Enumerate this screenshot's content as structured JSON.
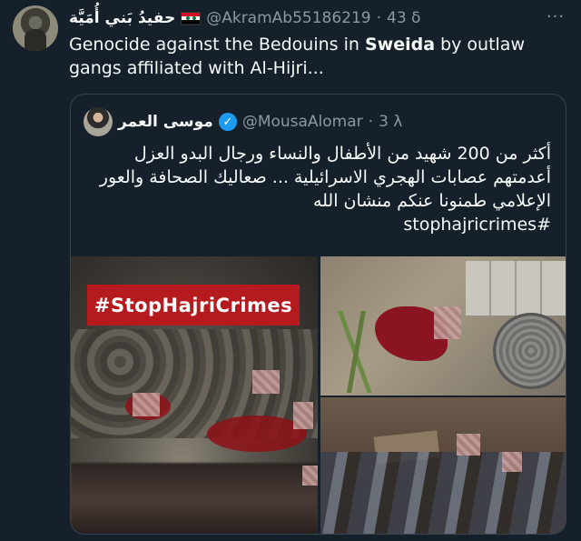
{
  "tweet": {
    "author_name": "حفيدُ بَني أُمَيَّة",
    "flag_icon": "syria-flag-icon",
    "handle": "@AkramAb55186219",
    "separator": "·",
    "time": "43 δ",
    "more_icon": "more-options-icon",
    "text_part1": "Genocide against the Bedouins in ",
    "text_bold": "Sweida",
    "text_part2": " by outlaw gangs affiliated with Al-Hijri..."
  },
  "quoted": {
    "author_name": "موسى العمر",
    "verified_icon": "verified-badge-icon",
    "handle": "@MousaAlomar",
    "separator": "·",
    "time": "3 λ",
    "text_line1": "أكثر من 200 شهيد من الأطفال والنساء ورجال البدو العزل",
    "text_line2": "أعدمتهم عصابات الهجري الاسرائيلية ... صعاليك الصحافة والعور",
    "text_line3": "الإعلامي طمنونا عنكم منشان الله",
    "hashtag": "#stophajricrimes",
    "media": {
      "banner_text": "#StopHajriCrimes",
      "image_count": 3
    }
  },
  "colors": {
    "background": "#15202b",
    "text": "#f7f9f9",
    "muted": "#8b98a5",
    "border": "#38444d",
    "verified": "#1d9bf0",
    "banner": "#b51a1f"
  }
}
